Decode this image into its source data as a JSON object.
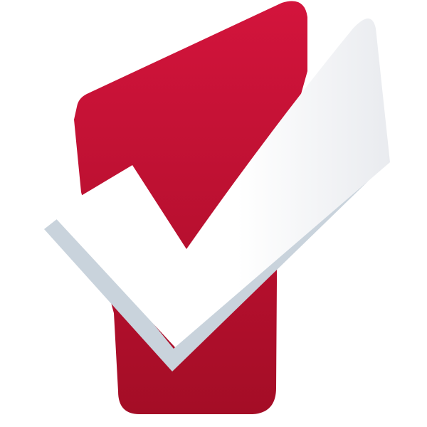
{
  "logo": {
    "icon_name": "checkmark-logo-icon",
    "colors": {
      "background": "#ffffff",
      "red_top": "#d3143c",
      "red_bottom": "#a40d26",
      "check_white": "#ffffff",
      "check_shade": "#e9ebef",
      "check_shadow": "#c9d3dc"
    }
  }
}
